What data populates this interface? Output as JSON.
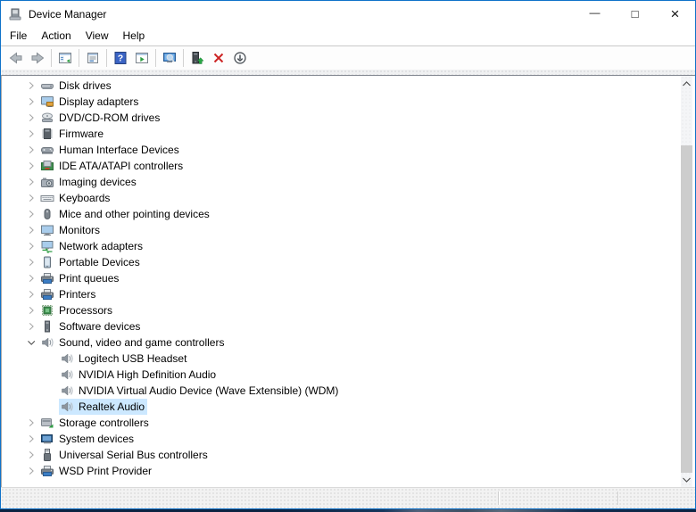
{
  "window": {
    "title": "Device Manager",
    "controls": {
      "minimize": "—",
      "maximize": "□",
      "close": "×"
    }
  },
  "menu": {
    "items": [
      "File",
      "Action",
      "View",
      "Help"
    ]
  },
  "toolbar": {
    "buttons": [
      {
        "name": "back-button",
        "icon": "back-icon",
        "disabled": true,
        "sep_after": false
      },
      {
        "name": "forward-button",
        "icon": "forward-icon",
        "disabled": true,
        "sep_after": true
      },
      {
        "name": "show-hide-console-tree-button",
        "icon": "console-tree-icon",
        "disabled": false,
        "sep_after": true
      },
      {
        "name": "properties-button",
        "icon": "properties-icon",
        "disabled": false,
        "sep_after": true
      },
      {
        "name": "help-button",
        "icon": "help-icon",
        "disabled": false,
        "sep_after": false
      },
      {
        "name": "show-hide-action-pane-button",
        "icon": "action-pane-icon",
        "disabled": false,
        "sep_after": true
      },
      {
        "name": "scan-for-hardware-changes-button",
        "icon": "scan-icon",
        "disabled": false,
        "sep_after": true
      },
      {
        "name": "update-driver-button",
        "icon": "update-driver-icon",
        "disabled": false,
        "sep_after": false
      },
      {
        "name": "uninstall-device-button",
        "icon": "uninstall-icon",
        "disabled": false,
        "sep_after": false
      },
      {
        "name": "disable-device-button",
        "icon": "disable-icon",
        "disabled": false,
        "sep_after": false
      }
    ]
  },
  "tree": {
    "items": [
      {
        "label": "Disk drives",
        "level": 0,
        "state": "collapsed",
        "icon": "disk-drive-icon",
        "selected": false
      },
      {
        "label": "Display adapters",
        "level": 0,
        "state": "collapsed",
        "icon": "display-adapter-icon",
        "selected": false
      },
      {
        "label": "DVD/CD-ROM drives",
        "level": 0,
        "state": "collapsed",
        "icon": "dvd-drive-icon",
        "selected": false
      },
      {
        "label": "Firmware",
        "level": 0,
        "state": "collapsed",
        "icon": "firmware-chip-icon",
        "selected": false
      },
      {
        "label": "Human Interface Devices",
        "level": 0,
        "state": "collapsed",
        "icon": "hid-gamepad-icon",
        "selected": false
      },
      {
        "label": "IDE ATA/ATAPI controllers",
        "level": 0,
        "state": "collapsed",
        "icon": "ide-controller-icon",
        "selected": false
      },
      {
        "label": "Imaging devices",
        "level": 0,
        "state": "collapsed",
        "icon": "imaging-camera-icon",
        "selected": false
      },
      {
        "label": "Keyboards",
        "level": 0,
        "state": "collapsed",
        "icon": "keyboard-icon",
        "selected": false
      },
      {
        "label": "Mice and other pointing devices",
        "level": 0,
        "state": "collapsed",
        "icon": "mouse-icon",
        "selected": false
      },
      {
        "label": "Monitors",
        "level": 0,
        "state": "collapsed",
        "icon": "monitor-icon",
        "selected": false
      },
      {
        "label": "Network adapters",
        "level": 0,
        "state": "collapsed",
        "icon": "network-adapter-icon",
        "selected": false
      },
      {
        "label": "Portable Devices",
        "level": 0,
        "state": "collapsed",
        "icon": "portable-device-icon",
        "selected": false
      },
      {
        "label": "Print queues",
        "level": 0,
        "state": "collapsed",
        "icon": "print-queue-icon",
        "selected": false
      },
      {
        "label": "Printers",
        "level": 0,
        "state": "collapsed",
        "icon": "printer-icon",
        "selected": false
      },
      {
        "label": "Processors",
        "level": 0,
        "state": "collapsed",
        "icon": "processor-icon",
        "selected": false
      },
      {
        "label": "Software devices",
        "level": 0,
        "state": "collapsed",
        "icon": "software-device-icon",
        "selected": false
      },
      {
        "label": "Sound, video and game controllers",
        "level": 0,
        "state": "expanded",
        "icon": "sound-speaker-icon",
        "selected": false
      },
      {
        "label": "Logitech USB Headset",
        "level": 1,
        "state": "leaf",
        "icon": "sound-speaker-icon",
        "selected": false
      },
      {
        "label": "NVIDIA High Definition Audio",
        "level": 1,
        "state": "leaf",
        "icon": "sound-speaker-icon",
        "selected": false
      },
      {
        "label": "NVIDIA Virtual Audio Device (Wave Extensible) (WDM)",
        "level": 1,
        "state": "leaf",
        "icon": "sound-speaker-icon",
        "selected": false
      },
      {
        "label": "Realtek Audio",
        "level": 1,
        "state": "leaf",
        "icon": "sound-speaker-icon",
        "selected": true
      },
      {
        "label": "Storage controllers",
        "level": 0,
        "state": "collapsed",
        "icon": "storage-controller-icon",
        "selected": false
      },
      {
        "label": "System devices",
        "level": 0,
        "state": "collapsed",
        "icon": "system-device-icon",
        "selected": false
      },
      {
        "label": "Universal Serial Bus controllers",
        "level": 0,
        "state": "collapsed",
        "icon": "usb-controller-icon",
        "selected": false
      },
      {
        "label": "WSD Print Provider",
        "level": 0,
        "state": "collapsed",
        "icon": "wsd-printer-icon",
        "selected": false
      }
    ]
  },
  "statusbar": {
    "panes": [
      "",
      "",
      ""
    ]
  },
  "colors": {
    "accent_border": "#0f72c9",
    "selection": "#cce8ff",
    "help_blue": "#3a63c4",
    "uninstall_red": "#cc2222",
    "update_green": "#28a745"
  }
}
